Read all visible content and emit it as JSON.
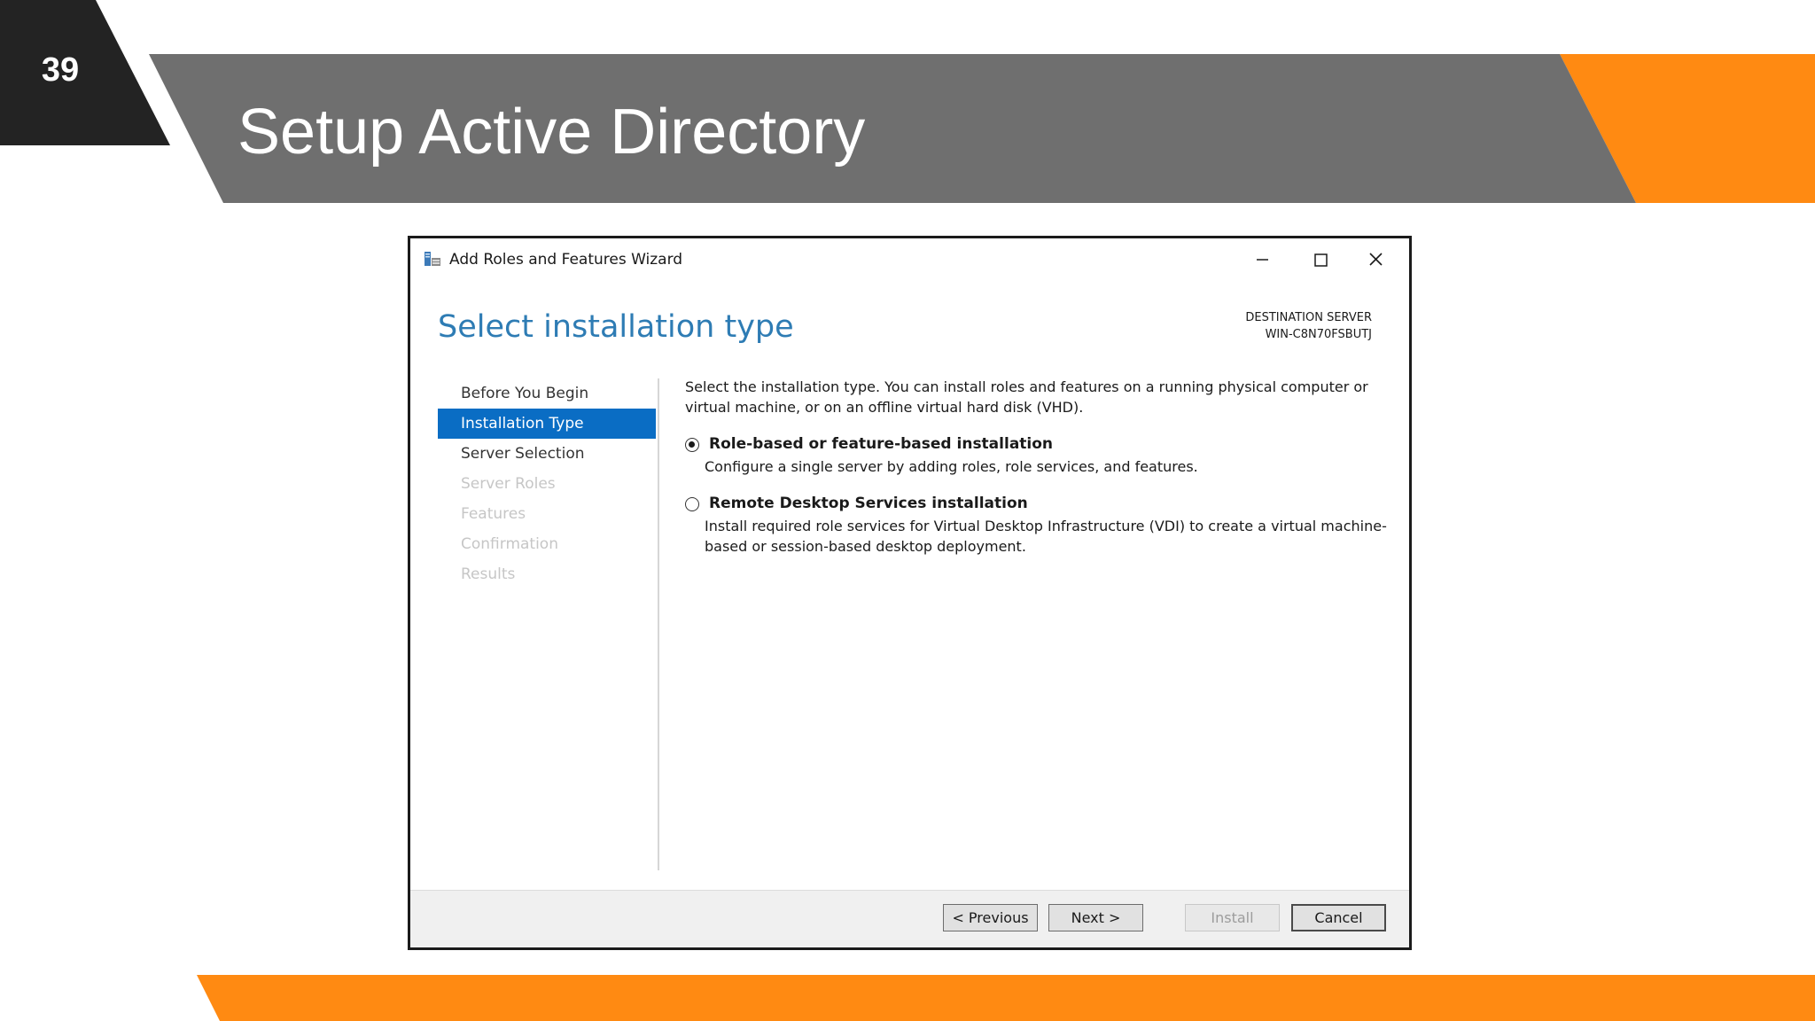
{
  "slide": {
    "number": "39",
    "title": "Setup Active Directory",
    "colors": {
      "dark": "#232323",
      "banner_gray": "#6f6f6f",
      "orange": "#ff8a12"
    }
  },
  "window": {
    "title": "Add Roles and Features Wizard",
    "icon": "server-manager-icon",
    "controls": [
      "minimize-icon",
      "maximize-icon",
      "close-icon"
    ],
    "heading": "Select installation type",
    "destination_label": "DESTINATION SERVER",
    "destination_value": "WIN-C8N70FSBUTJ",
    "nav": [
      {
        "label": "Before You Begin",
        "state": "normal"
      },
      {
        "label": "Installation Type",
        "state": "active"
      },
      {
        "label": "Server Selection",
        "state": "normal"
      },
      {
        "label": "Server Roles",
        "state": "disabled"
      },
      {
        "label": "Features",
        "state": "disabled"
      },
      {
        "label": "Confirmation",
        "state": "disabled"
      },
      {
        "label": "Results",
        "state": "disabled"
      }
    ],
    "description": "Select the installation type. You can install roles and features on a running physical computer or virtual machine, or on an offline virtual hard disk (VHD).",
    "options": [
      {
        "label": "Role-based or feature-based installation",
        "desc": "Configure a single server by adding roles, role services, and features.",
        "selected": true
      },
      {
        "label": "Remote Desktop Services installation",
        "desc": "Install required role services for Virtual Desktop Infrastructure (VDI) to create a virtual machine-based or session-based desktop deployment.",
        "selected": false
      }
    ],
    "buttons": {
      "previous": "< Previous",
      "next": "Next >",
      "install": "Install",
      "cancel": "Cancel"
    },
    "accent": "#0a6dc4",
    "heading_color": "#2e7cb4"
  }
}
